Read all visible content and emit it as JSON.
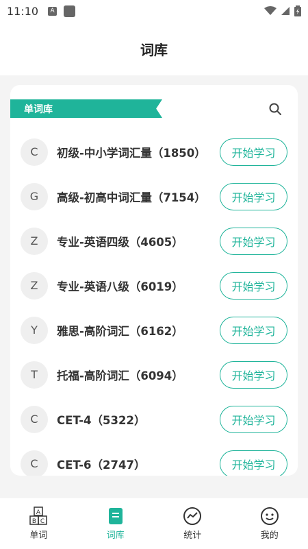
{
  "status": {
    "time": "11:10",
    "a_label": "A"
  },
  "header": {
    "title": "词库"
  },
  "section": {
    "label": "单词库"
  },
  "books": [
    {
      "initial": "C",
      "title": "初级-中小学词汇量（1850）",
      "button": "开始学习"
    },
    {
      "initial": "G",
      "title": "高级-初高中词汇量（7154）",
      "button": "开始学习"
    },
    {
      "initial": "Z",
      "title": "专业-英语四级（4605）",
      "button": "开始学习"
    },
    {
      "initial": "Z",
      "title": "专业-英语八级（6019）",
      "button": "开始学习"
    },
    {
      "initial": "Y",
      "title": "雅思-高阶词汇（6162）",
      "button": "开始学习"
    },
    {
      "initial": "T",
      "title": "托福-高阶词汇（6094）",
      "button": "开始学习"
    },
    {
      "initial": "C",
      "title": "CET-4（5322）",
      "button": "开始学习"
    },
    {
      "initial": "C",
      "title": "CET-6（2747）",
      "button": "开始学习"
    }
  ],
  "tabs": [
    {
      "label": "单词",
      "icon": "abc-blocks-icon",
      "active": false
    },
    {
      "label": "词库",
      "icon": "book-icon",
      "active": true
    },
    {
      "label": "统计",
      "icon": "chart-icon",
      "active": false
    },
    {
      "label": "我的",
      "icon": "face-icon",
      "active": false
    }
  ],
  "colors": {
    "accent": "#1fb49a",
    "background": "#f4f4f4"
  }
}
